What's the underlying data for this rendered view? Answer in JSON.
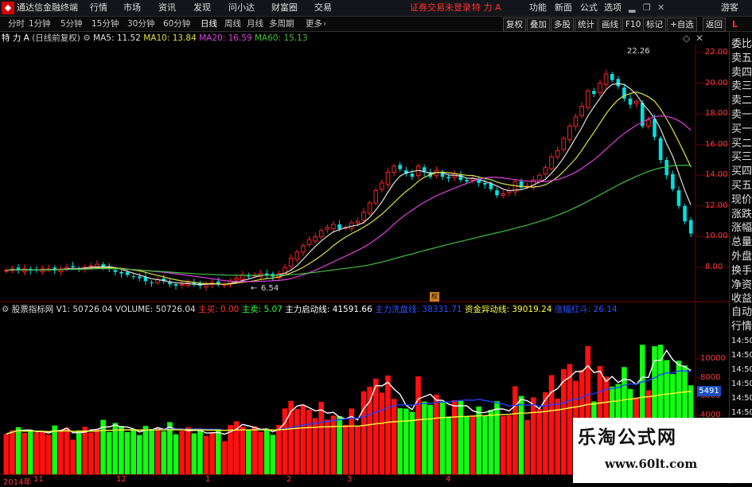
{
  "menubar": {
    "app_title": "通达信金融终端",
    "menus": [
      "行情",
      "市场",
      "资讯",
      "发现",
      "问小达",
      "财富圈",
      "交易"
    ],
    "notice": "证券交易未登录",
    "stock": "特 力 A",
    "right": [
      "功能",
      "新面",
      "公式",
      "选项"
    ],
    "guest": "游客"
  },
  "periods": {
    "tabs": [
      "分时",
      "1分钟",
      "5分钟",
      "15分钟",
      "30分钟",
      "60分钟",
      "日线",
      "周线",
      "月线",
      "多周期",
      "更多"
    ],
    "active": "日线"
  },
  "right_tools": [
    "复权",
    "叠加",
    "多股",
    "统计",
    "画线",
    "F10",
    "标记",
    "+自选",
    "返回"
  ],
  "main_info": {
    "title": "特 力 A",
    "mode": "(日线前复权)",
    "ma5": "MA5: 11.52",
    "ma10": "MA10: 13.84",
    "ma20": "MA20: 16.59",
    "ma60": "MA60: 15.13"
  },
  "price_axis": [
    "22.00",
    "20.00",
    "18.00",
    "16.00",
    "14.00",
    "12.00",
    "10.00",
    "8.00"
  ],
  "annotations": {
    "high": "22.26",
    "low": "6.54"
  },
  "lower_info": {
    "name": "股票指标网",
    "v1": "V1: 50726.04",
    "volume": "VOLUME: 50726.04",
    "buy": "主买: 0.00",
    "sell": "主卖: 5.07",
    "start": "主力启动线: 41591.66",
    "wave": "主力洗盘线: 38331.71",
    "fund": "资金异动线: 39019.24",
    "sign": "涨幅红斗: 26.14"
  },
  "volume_axis": [
    "10000",
    "8000",
    "6000",
    "4000"
  ],
  "volume_marker": "5491",
  "time_axis": [
    "2014年",
    "11",
    "12",
    "1",
    "2",
    "3",
    "4"
  ],
  "side_panel": {
    "top_flag": "L",
    "items": [
      "委比",
      "卖五",
      "卖四",
      "卖三",
      "卖二",
      "卖一",
      "买一",
      "买二",
      "买三",
      "买四",
      "买五",
      "现价",
      "涨跌",
      "涨幅",
      "总量",
      "外盘",
      "换手",
      "净资",
      "收益"
    ],
    "lower_items": [
      "自动",
      "行情",
      "14:50",
      "14:50",
      "14:50",
      "14:50",
      "14:50",
      "14:50",
      "14:50",
      "14:50",
      "14:50"
    ]
  },
  "watermark": {
    "title": "乐淘公式网",
    "url": "www.60lt.com"
  },
  "colors": {
    "up": "#ff2020",
    "down": "#00e0e0",
    "ma5": "#e0e0e0",
    "ma10": "#e0e040",
    "ma20": "#e040e0",
    "ma60": "#40c040"
  },
  "chart_data": {
    "type": "candlestick",
    "series_note": "daily K-line, approximate closes",
    "closes": [
      7.8,
      7.9,
      7.8,
      7.9,
      7.8,
      7.8,
      7.9,
      7.9,
      7.8,
      7.9,
      8.0,
      8.0,
      7.9,
      8.0,
      8.1,
      8.2,
      8.0,
      7.9,
      7.7,
      7.6,
      7.5,
      7.4,
      7.3,
      7.1,
      7.0,
      7.2,
      7.1,
      6.9,
      6.8,
      6.9,
      7.0,
      6.9,
      6.8,
      6.9,
      7.0,
      6.9,
      6.9,
      7.1,
      7.3,
      7.5,
      7.4,
      7.5,
      7.6,
      7.5,
      7.4,
      7.6,
      8.0,
      8.6,
      9.0,
      9.4,
      9.8,
      10.0,
      10.4,
      10.6,
      10.8,
      10.5,
      10.6,
      10.9,
      11.0,
      11.6,
      12.2,
      13.0,
      13.5,
      14.2,
      14.6,
      14.4,
      14.1,
      13.9,
      14.6,
      14.2,
      13.9,
      14.3,
      13.9,
      13.8,
      14.1,
      13.7,
      13.6,
      13.8,
      13.5,
      13.4,
      13.1,
      12.7,
      12.8,
      13.0,
      13.6,
      13.2,
      13.3,
      13.7,
      14.0,
      14.5,
      15.2,
      15.6,
      16.4,
      17.2,
      17.8,
      18.5,
      19.5,
      19.3,
      20.0,
      20.6,
      20.2,
      19.8,
      19.0,
      18.6,
      18.8,
      17.2,
      17.6,
      16.5,
      15.0,
      14.0,
      13.1,
      12.0,
      11.0,
      10.2
    ]
  }
}
